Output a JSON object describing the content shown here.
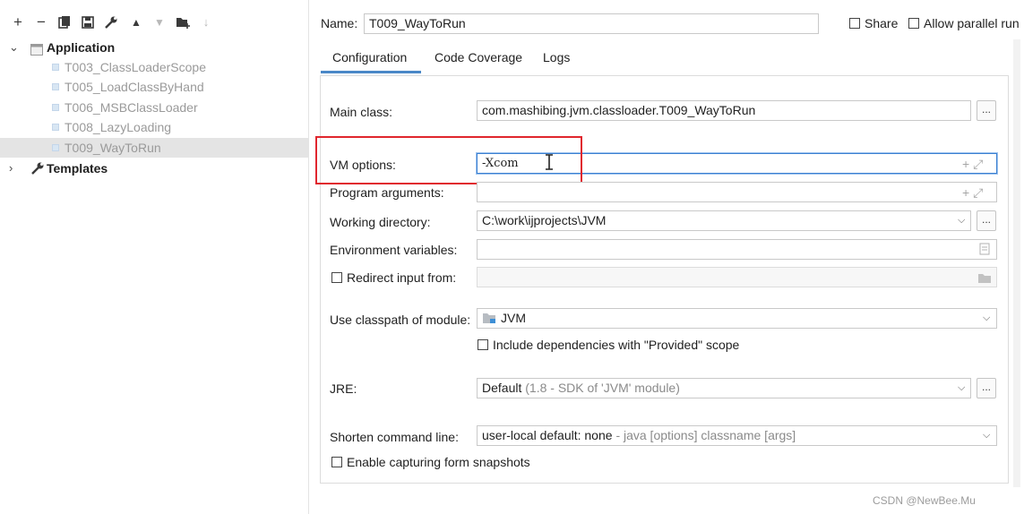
{
  "toolbar": {
    "add": "+",
    "remove": "−",
    "copy": "⧉",
    "save": "💾",
    "edit": "🔧",
    "move_up": "▲",
    "move_down": "▼",
    "folder": "⊞",
    "sort": "↓"
  },
  "tree": {
    "application": {
      "label": "Application",
      "children": [
        "T003_ClassLoaderScope",
        "T005_LoadClassByHand",
        "T006_MSBClassLoader",
        "T008_LazyLoading",
        "T009_WayToRun"
      ]
    },
    "templates": {
      "label": "Templates"
    }
  },
  "header": {
    "name_label": "Name:",
    "name_value": "T009_WayToRun",
    "share_label": "Share",
    "parallel_label": "Allow parallel run"
  },
  "tabs": [
    "Configuration",
    "Code Coverage",
    "Logs"
  ],
  "form": {
    "main_class_label": "Main class:",
    "main_class_value": "com.mashibing.jvm.classloader.T009_WayToRun",
    "vm_options_label": "VM options:",
    "vm_options_value": "-Xcom",
    "program_args_label": "Program arguments:",
    "working_dir_label": "Working directory:",
    "working_dir_value": "C:\\work\\ijprojects\\JVM",
    "env_vars_label": "Environment variables:",
    "redirect_label": "Redirect input from:",
    "classpath_label": "Use classpath of module:",
    "classpath_value": "JVM",
    "include_deps_label": "Include dependencies with \"Provided\" scope",
    "jre_label": "JRE:",
    "jre_value": "Default",
    "jre_hint": "(1.8 - SDK of 'JVM' module)",
    "shorten_label": "Shorten command line:",
    "shorten_value": "user-local default: none",
    "shorten_hint": "- java [options] classname [args]",
    "capture_label": "Enable capturing form snapshots",
    "ellipsis": "...",
    "expand_plus": "+ ⤢"
  },
  "watermark": "CSDN @NewBee.Mu",
  "colors": {
    "accent": "#3a7fd1",
    "highlight_box": "#e0262e",
    "tab_underline": "#4a88c7"
  }
}
